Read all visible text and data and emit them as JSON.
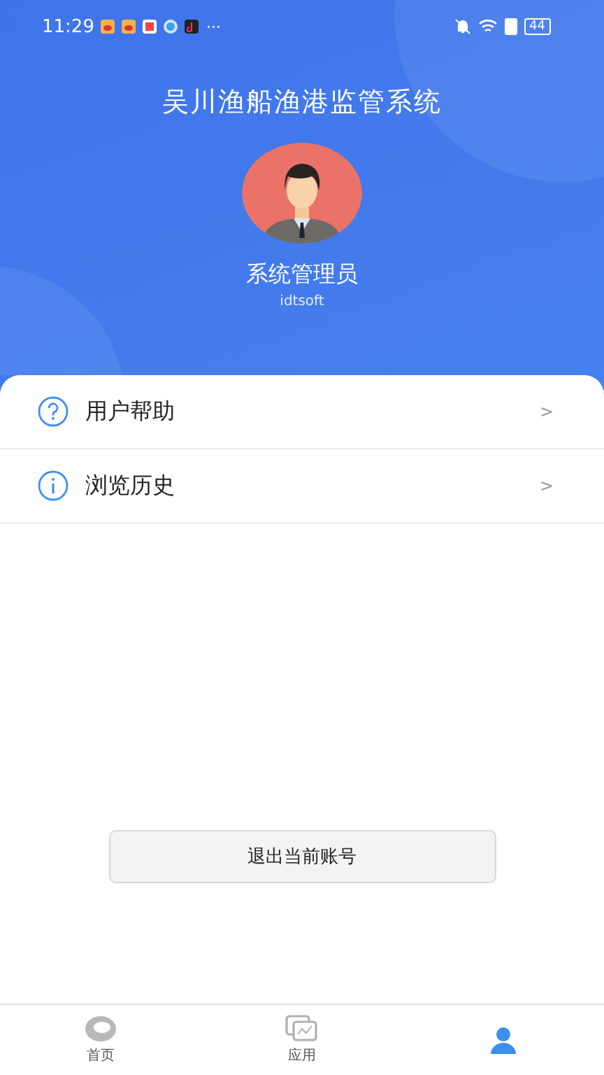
{
  "status_bar": {
    "time": "11:29",
    "more": "···",
    "battery": "44"
  },
  "header": {
    "title": "吴川渔船渔港监管系统",
    "user_name": "系统管理员",
    "user_id": "idtsoft"
  },
  "menu": [
    {
      "label": "用户帮助",
      "kind": "help",
      "chevron": ">"
    },
    {
      "label": "浏览历史",
      "kind": "info",
      "chevron": ">"
    }
  ],
  "logout_button": "退出当前账号",
  "bottom_nav": [
    {
      "label": "首页",
      "kind": "home",
      "selected": false
    },
    {
      "label": "应用",
      "kind": "apps",
      "selected": false
    },
    {
      "kind": "user",
      "selected": true
    }
  ]
}
